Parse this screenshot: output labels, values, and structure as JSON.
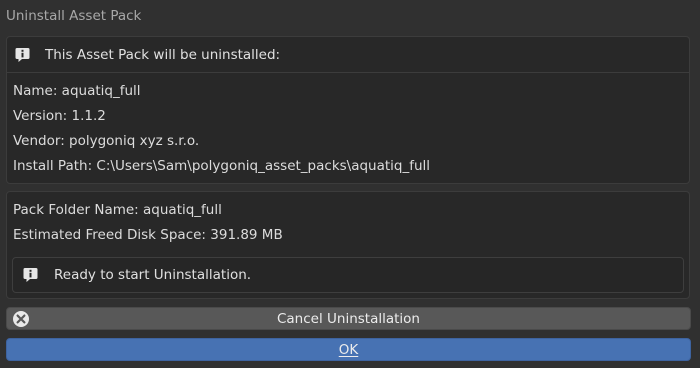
{
  "dialog": {
    "title": "Uninstall Asset Pack"
  },
  "details": {
    "header_icon": "info-icon",
    "header": "This Asset Pack will be uninstalled:",
    "name": "Name: aquatiq_full",
    "version": "Version: 1.1.2",
    "vendor": "Vendor: polygoniq xyz s.r.o.",
    "install_path": "Install Path: C:\\Users\\Sam\\polygoniq_asset_packs\\aquatiq_full"
  },
  "summary": {
    "folder_name": "Pack Folder Name: aquatiq_full",
    "freed_space": "Estimated Freed Disk Space: 391.89 MB",
    "status_icon": "info-icon",
    "status": "Ready to start Uninstallation."
  },
  "buttons": {
    "cancel_icon": "cancel-circle-icon",
    "cancel_label": "Cancel Uninstallation",
    "ok_label": "OK"
  },
  "colors": {
    "background": "#303030",
    "panel": "#282828",
    "cancel_button": "#585858",
    "ok_button": "#4772b3"
  }
}
